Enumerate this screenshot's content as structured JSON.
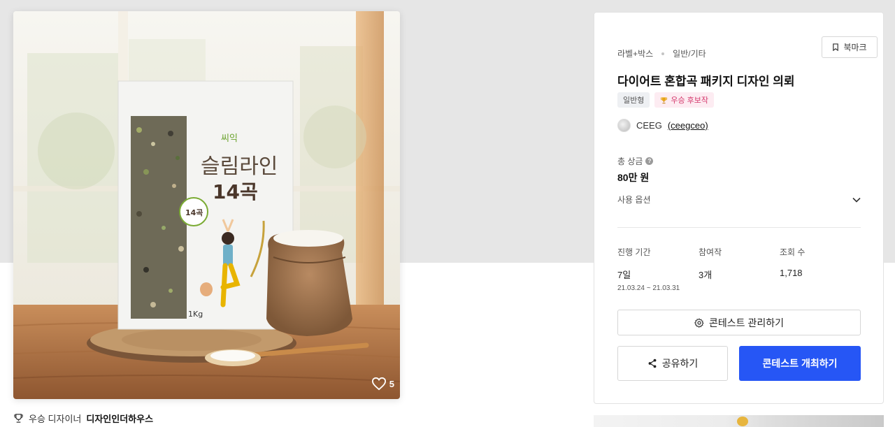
{
  "product_image": {
    "brand_text": "씨익",
    "product_name_line1": "슬림라인",
    "product_name_line2": "14곡",
    "seal_text": "14곡",
    "weight_text": "1Kg",
    "like_count": "5"
  },
  "winner": {
    "label": "우승 디자이너",
    "designer_name": "디자인인더하우스"
  },
  "panel": {
    "category_main": "라벨+박스",
    "category_sub": "일반/기타",
    "bookmark_label": "북마크",
    "title": "다이어트 혼합곡 패키지 디자인 의뢰",
    "badge_type": "일반형",
    "badge_winner": "우승 후보작",
    "host_name": "CEEG",
    "host_handle": "(ceegceo)",
    "prize_label": "총 상금",
    "prize_help": "?",
    "prize_value": "80만 원",
    "options_label": "사용 옵션",
    "stats": {
      "period_label": "진행 기간",
      "period_value": "7일",
      "period_range": "21.03.24 ~ 21.03.31",
      "entries_label": "참여작",
      "entries_value": "3개",
      "views_label": "조회 수",
      "views_value": "1,718"
    },
    "manage_button": "콘테스트 관리하기",
    "share_button": "공유하기",
    "host_button": "콘테스트 개최하기"
  },
  "colors": {
    "primary": "#2656f5",
    "winner_badge_text": "#d4386c",
    "winner_badge_bg": "#fdecf2"
  },
  "icons": [
    "bookmark-icon",
    "trophy-icon",
    "help-icon",
    "chevron-down-icon",
    "gear-icon",
    "share-icon",
    "heart-icon"
  ]
}
